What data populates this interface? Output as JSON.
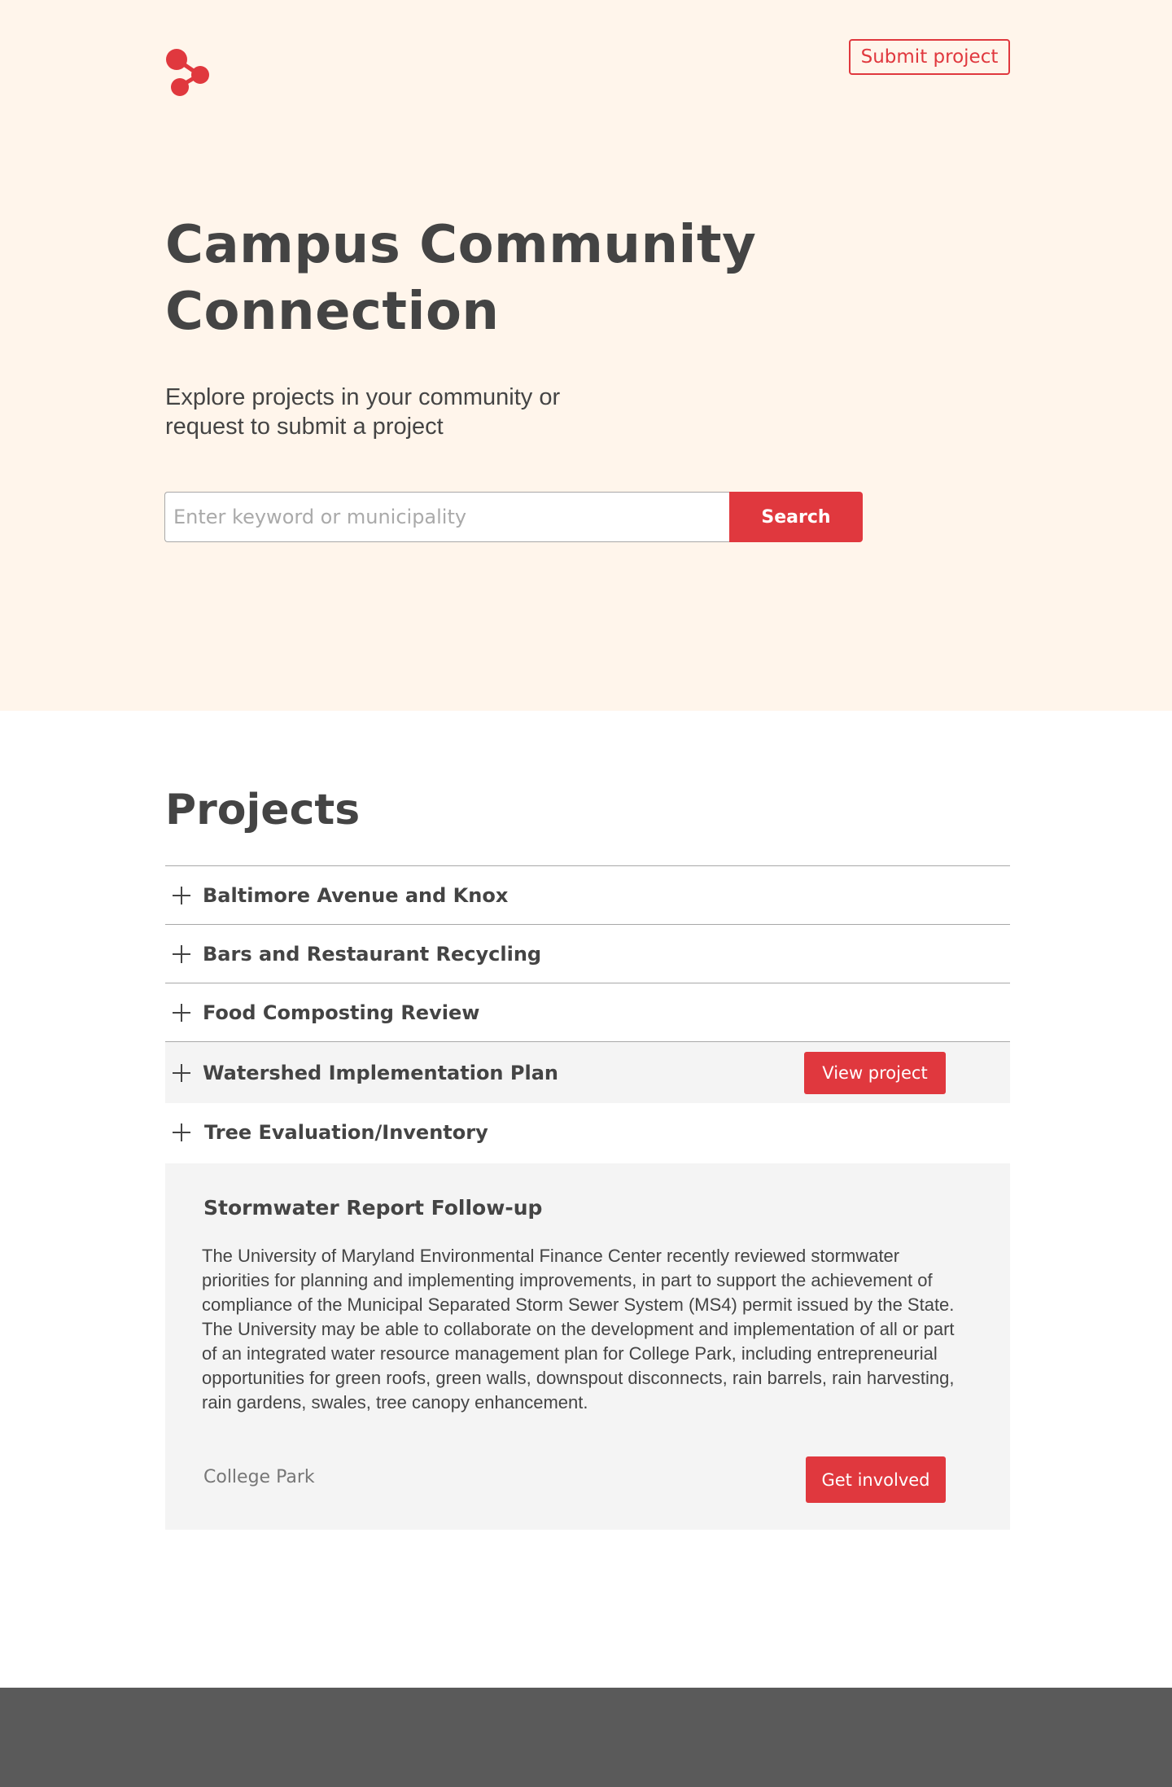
{
  "header": {
    "logo_icon": "molecule-logo-icon",
    "submit_label": "Submit project"
  },
  "hero": {
    "title": "Campus Community Connection",
    "subtitle": "Explore projects in your community or request to submit a project",
    "search_placeholder": "Enter keyword or municipality",
    "search_value": "",
    "search_button": "Search"
  },
  "projects": {
    "heading": "Projects",
    "items": [
      {
        "label": "Baltimore Avenue and Knox"
      },
      {
        "label": "Bars and Restaurant Recycling"
      },
      {
        "label": "Food Composting Review"
      },
      {
        "label": "Watershed Implementation Plan",
        "action": "View project"
      },
      {
        "label": "Tree Evaluation/Inventory"
      }
    ],
    "expanded": {
      "title": "Stormwater Report Follow-up",
      "body": "The University of Maryland Environmental Finance Center recently reviewed stormwater priorities for planning and implementing improvements, in part to support the achievement of compliance of the Municipal Separated Storm Sewer System (MS4) permit issued by the State.  The University may be able to collaborate on the development and implementation of all or part of an integrated water resource management plan for College Park, including entrepreneurial opportunities for green roofs, green walls, downspout disconnects, rain barrels, rain harvesting, rain gardens, swales, tree canopy enhancement.",
      "location": "College Park",
      "action": "Get involved"
    }
  },
  "colors": {
    "accent": "#e0383e",
    "hero_bg": "#fff5eb",
    "text": "#444444",
    "panel_bg": "#f4f4f4",
    "footer_bg": "#5a5a5a"
  }
}
